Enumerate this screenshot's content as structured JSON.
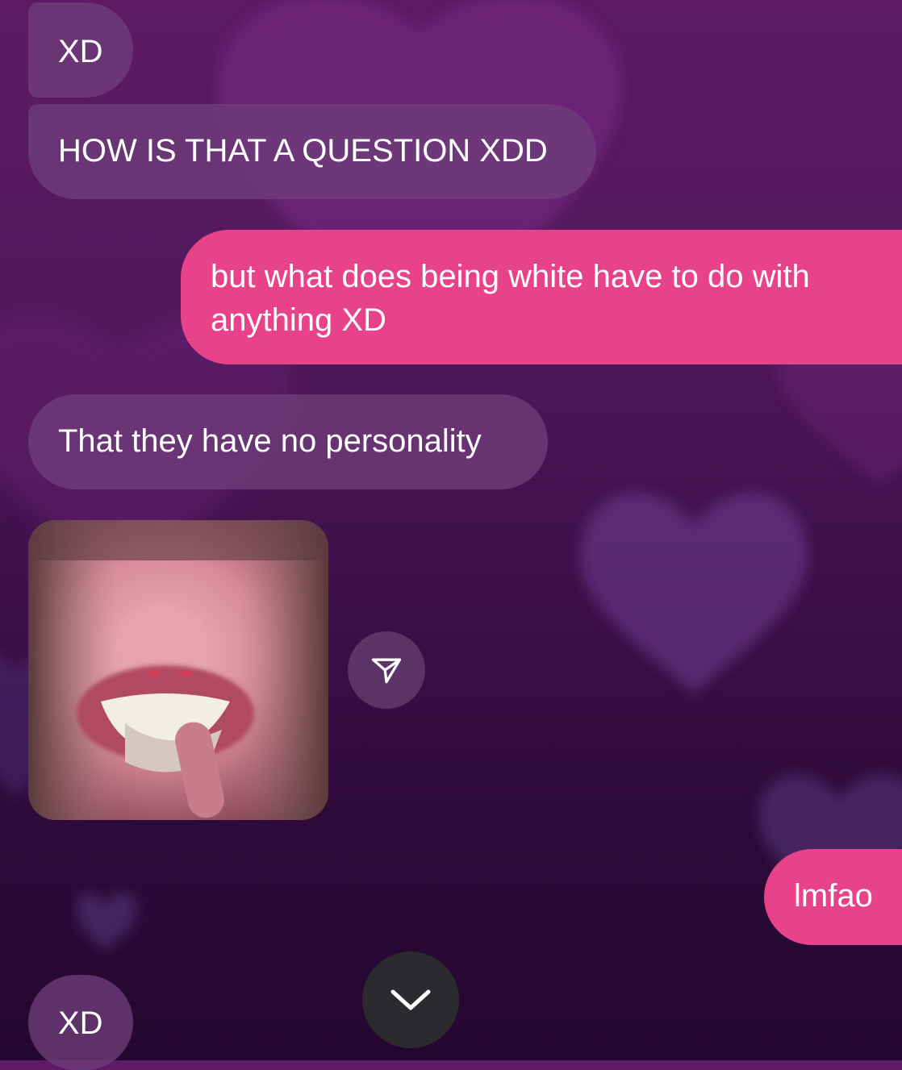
{
  "messages": [
    {
      "side": "incoming",
      "text": "XD"
    },
    {
      "side": "incoming",
      "text": "HOW IS THAT A QUESTION XDD"
    },
    {
      "side": "outgoing",
      "text": "but what does being white have to do with anything XD"
    },
    {
      "side": "incoming",
      "text": "That they have no personality"
    },
    {
      "side": "incoming",
      "type": "photo",
      "overlay_emoji": "👄👄"
    },
    {
      "side": "outgoing",
      "text": "lmfao"
    },
    {
      "side": "incoming",
      "text": "XD"
    }
  ],
  "icons": {
    "share": "paper-plane-icon",
    "scroll_down": "chevron-down-icon"
  },
  "colors": {
    "background_top": "#5e1a66",
    "background_bottom": "#24072f",
    "incoming_bubble": "#703e7a",
    "outgoing_bubble": "#e8428a",
    "scroll_button": "#2b2a2e"
  }
}
